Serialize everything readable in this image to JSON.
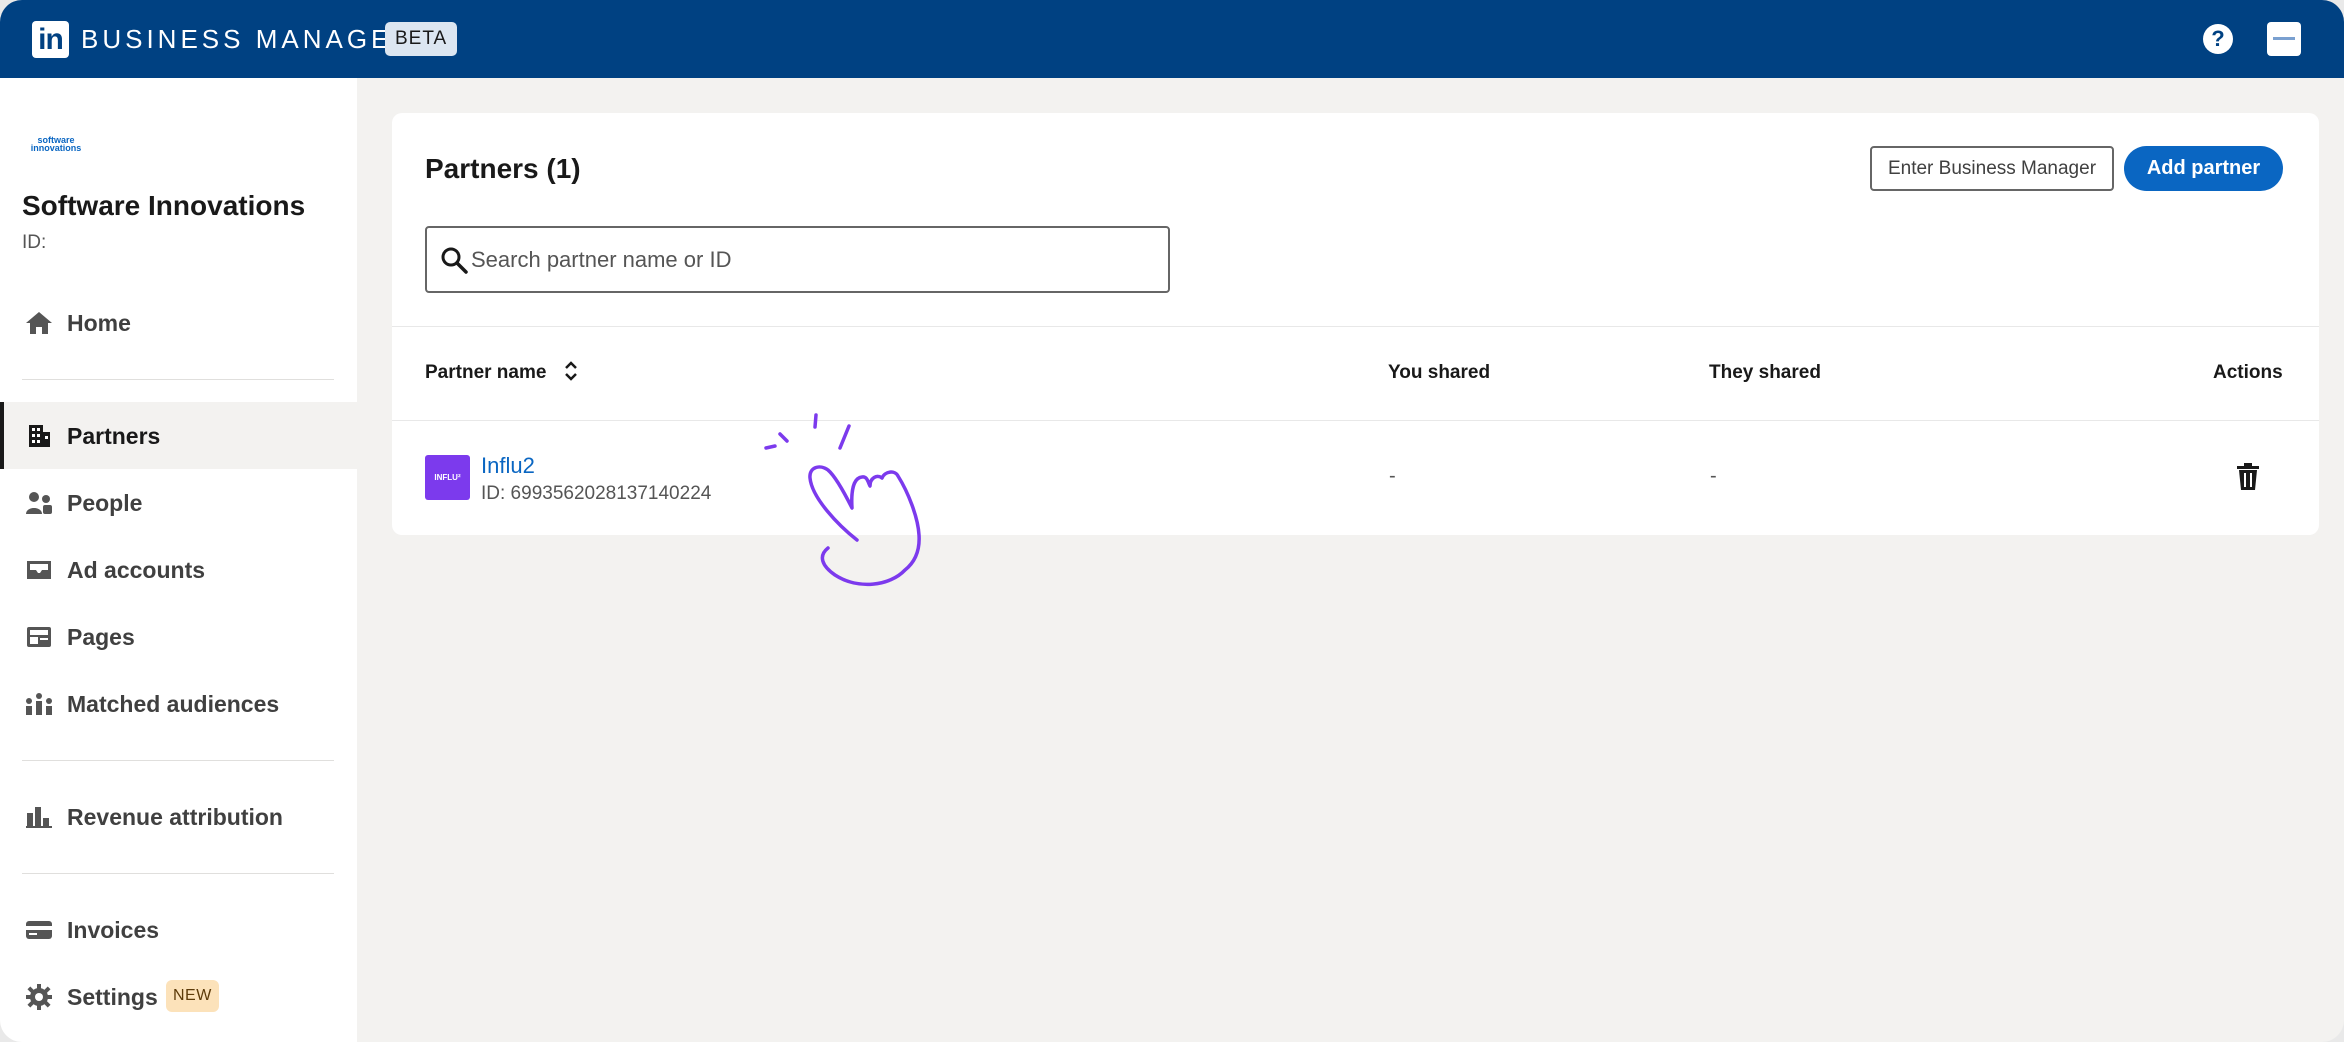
{
  "header": {
    "logo_text": "in",
    "brand": "BUSINESS MANAGER",
    "beta_badge": "BETA",
    "help_icon": "?"
  },
  "sidebar": {
    "org_logo_text": "software innovations",
    "org_name": "Software Innovations",
    "org_id": "ID:",
    "items": [
      {
        "label": "Home",
        "icon": "home-icon"
      },
      {
        "label": "Partners",
        "icon": "building-icon",
        "active": true
      },
      {
        "label": "People",
        "icon": "people-icon"
      },
      {
        "label": "Ad accounts",
        "icon": "inbox-icon"
      },
      {
        "label": "Pages",
        "icon": "page-icon"
      },
      {
        "label": "Matched audiences",
        "icon": "audience-icon"
      },
      {
        "label": "Revenue attribution",
        "icon": "bar-chart-icon"
      },
      {
        "label": "Invoices",
        "icon": "credit-card-icon"
      },
      {
        "label": "Settings",
        "icon": "gear-icon",
        "badge": "NEW"
      }
    ]
  },
  "main": {
    "title": "Partners (1)",
    "enter_bm_label": "Enter Business Manager",
    "add_partner_label": "Add partner",
    "search_placeholder": "Search partner name or ID",
    "columns": [
      "Partner name",
      "You shared",
      "They shared",
      "Actions"
    ],
    "rows": [
      {
        "logo_text": "INFLU²",
        "name": "Influ2",
        "id": "ID: 6993562028137140224",
        "you_shared": "-",
        "they_shared": "-"
      }
    ]
  },
  "colors": {
    "topbar": "#004182",
    "accent": "#0a66c2",
    "partner_logo": "#7c3aed",
    "doodle": "#7c3aed"
  }
}
